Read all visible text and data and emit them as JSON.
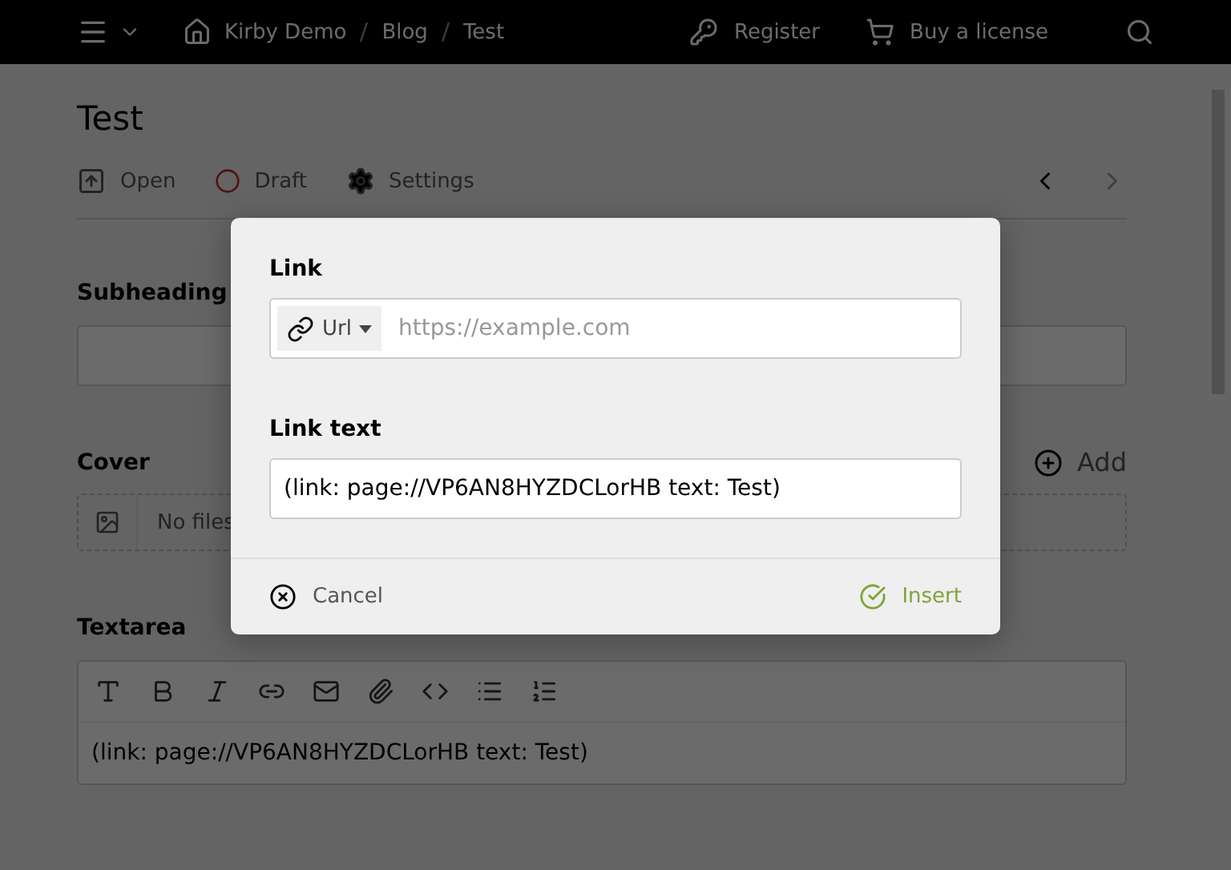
{
  "topbar": {
    "breadcrumb": [
      "Kirby Demo",
      "Blog",
      "Test"
    ],
    "actions": [
      {
        "kind": "register",
        "label": "Register"
      },
      {
        "kind": "license",
        "label": "Buy a license"
      }
    ]
  },
  "page": {
    "title": "Test",
    "toolbar": [
      {
        "kind": "open",
        "label": "Open"
      },
      {
        "kind": "status",
        "label": "Draft"
      },
      {
        "kind": "settings",
        "label": "Settings"
      }
    ],
    "nav": [
      {
        "kind": "prev",
        "disabled": false
      },
      {
        "kind": "next",
        "disabled": true
      }
    ],
    "fields": [
      {
        "kind": "text",
        "label": "Subheading"
      },
      {
        "kind": "files",
        "label": "Cover",
        "action": "Add",
        "empty": "No files"
      },
      {
        "kind": "textarea",
        "label": "Textarea",
        "value": "(link: page://VP6AN8HYZDCLorHB text: Test)"
      }
    ]
  },
  "dialog": {
    "fields": [
      {
        "kind": "url",
        "label": "Link",
        "type_label": "Url",
        "placeholder": "https://example.com"
      },
      {
        "kind": "text",
        "label": "Link text",
        "value": "(link: page://VP6AN8HYZDCLorHB text: Test)"
      }
    ],
    "cancel": "Cancel",
    "submit": "Insert"
  }
}
